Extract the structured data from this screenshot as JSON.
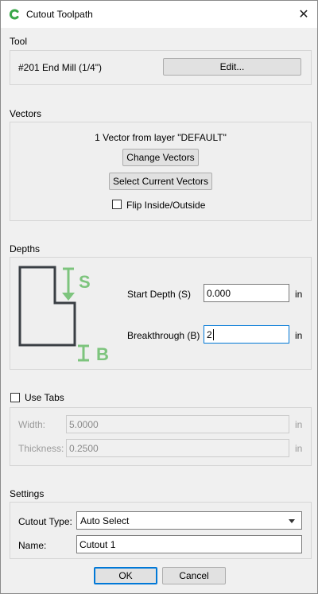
{
  "window": {
    "title": "Cutout Toolpath",
    "close_glyph": "✕"
  },
  "tool": {
    "section_label": "Tool",
    "name": "#201 End Mill (1/4\")",
    "edit_label": "Edit..."
  },
  "vectors": {
    "section_label": "Vectors",
    "info": "1 Vector from layer \"DEFAULT\"",
    "change_label": "Change Vectors",
    "select_label": "Select Current Vectors",
    "flip_label": "Flip Inside/Outside",
    "flip_checked": false
  },
  "depths": {
    "section_label": "Depths",
    "diagram_start_letter": "S",
    "diagram_breakthrough_letter": "B",
    "start_label": "Start Depth (S)",
    "start_value": "0.000",
    "start_unit": "in",
    "breakthrough_label": "Breakthrough (B)",
    "breakthrough_value": "2",
    "breakthrough_unit": "in"
  },
  "tabs": {
    "use_tabs_label": "Use Tabs",
    "use_tabs_checked": false,
    "width_label": "Width:",
    "width_value": "5.0000",
    "width_unit": "in",
    "thickness_label": "Thickness:",
    "thickness_value": "0.2500",
    "thickness_unit": "in"
  },
  "settings": {
    "section_label": "Settings",
    "cutout_type_label": "Cutout Type:",
    "cutout_type_value": "Auto Select",
    "name_label": "Name:",
    "name_value": "Cutout 1"
  },
  "footer": {
    "ok_label": "OK",
    "cancel_label": "Cancel"
  },
  "colors": {
    "diagram_green": "#7dc47d",
    "diagram_outline": "#3a3f44",
    "focus_blue": "#0078d7"
  }
}
